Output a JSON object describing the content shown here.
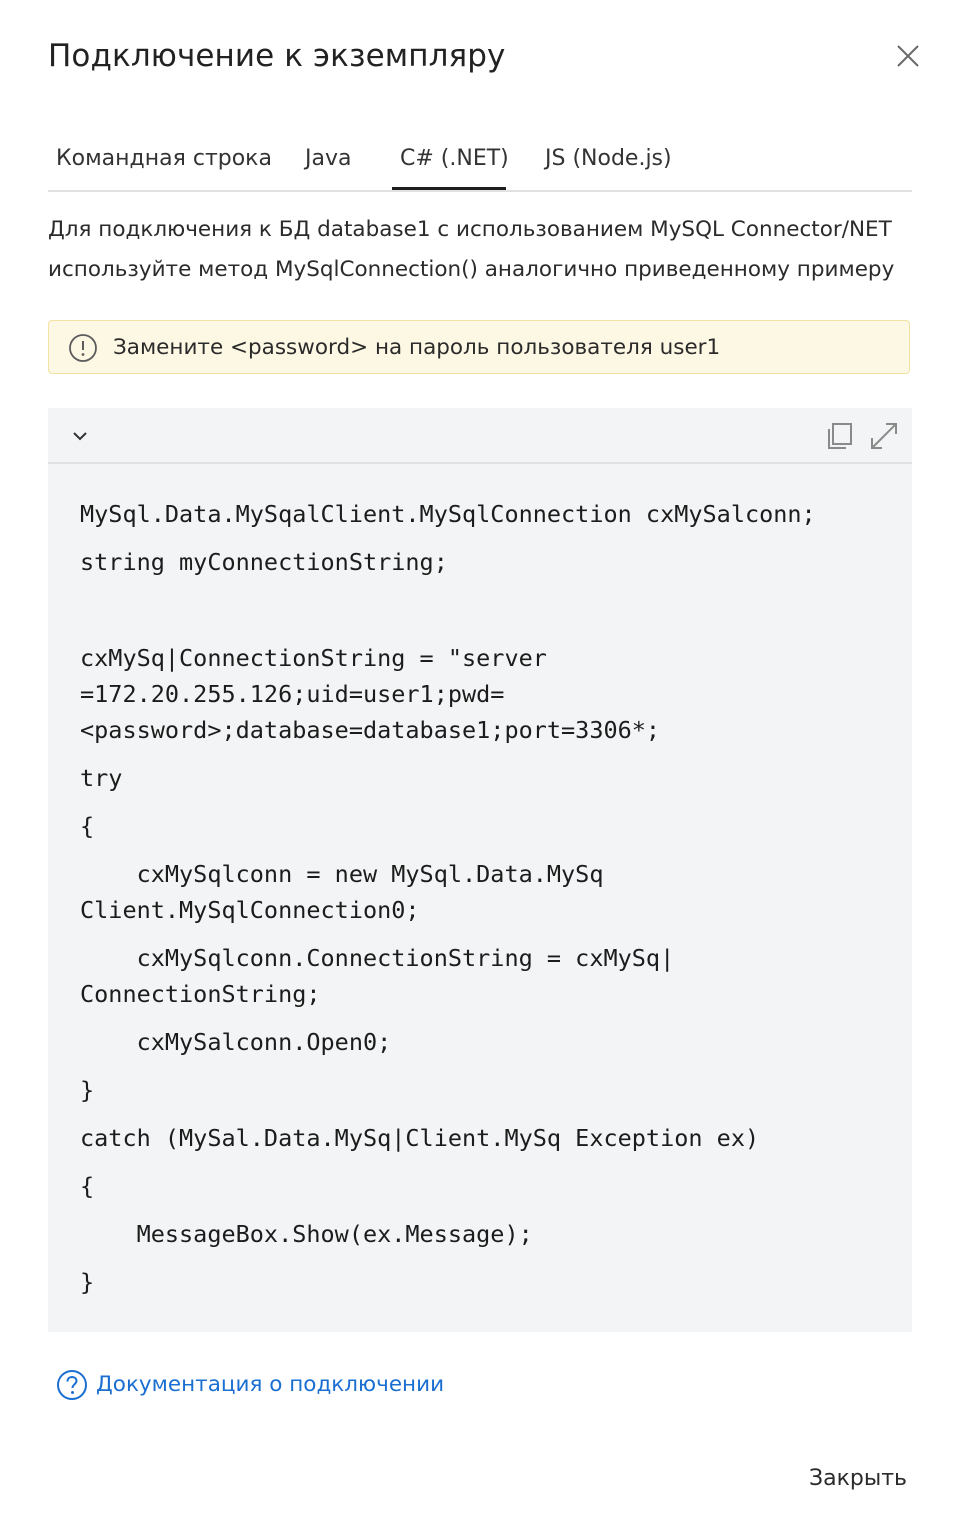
{
  "dialog": {
    "title": "Подключение к экземпляру",
    "close_icon": "close-icon"
  },
  "tabs": [
    {
      "label": "Командная строка",
      "active": false
    },
    {
      "label": "Java",
      "active": false
    },
    {
      "label": "C# (.NET)",
      "active": true
    },
    {
      "label": "JS (Node.js)",
      "active": false
    }
  ],
  "description": {
    "line1": "Для подключения к БД database1 с использованием MySQL Connector/NET",
    "line2": "используйте метод MySqlConnection() аналогично приведенному примеру"
  },
  "notice": {
    "icon": "warning-circle-icon",
    "text": "Замените <password> на пароль пользователя user1"
  },
  "code_block": {
    "collapse_icon": "chevron-down-icon",
    "copy_icon": "copy-icon",
    "expand_icon": "expand-icon",
    "lines": [
      "MySql.Data.MySqalClient.MySqlConnection cxMySalconn;",
      "string myConnectionString;",
      "cxMySq|ConnectionString = \"server",
      "=172.20.255.126;uid=user1;pwd=",
      "<password>;database=database1;port=3306*;",
      "try",
      "{",
      "    cxMySqlconn = new MySql.Data.MySq",
      "Client.MySqlConnection0;",
      "    cxMySqlconn.ConnectionString = cxMySq|",
      "ConnectionString;",
      "    cxMySalconn.Open0;",
      "}",
      "catch (MySal.Data.MySq|Client.MySq Exception ex)",
      "{",
      "    MessageBox.Show(ex.Message);",
      "}"
    ]
  },
  "doc_link": {
    "icon": "help-circle-icon",
    "label": "Документация о подключении"
  },
  "footer": {
    "close_label": "Закрыть"
  },
  "colors": {
    "link": "#1a6fd1",
    "notice_bg": "#fdf8e4",
    "notice_border": "#f2e2a4",
    "code_bg": "#f3f4f5"
  }
}
